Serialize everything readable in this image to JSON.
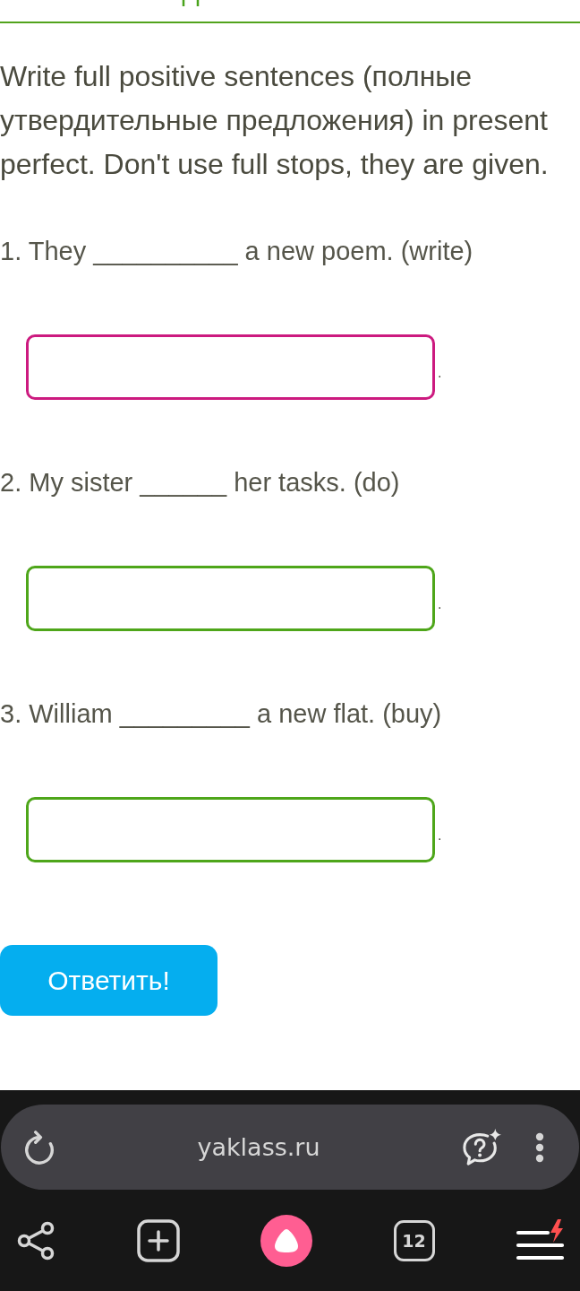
{
  "instruction": "Write full positive sentences (полные утвердительные предложения) in present perfect. Don't use full stops, they are given.",
  "questions": [
    {
      "prompt": "1. They __________ a new poem. (write)",
      "answer": {
        "focused": true
      },
      "end_mark": "."
    },
    {
      "prompt": "2. My sister ______ her tasks. (do)",
      "answer": {
        "focused": false
      },
      "end_mark": "."
    },
    {
      "prompt": "3. William _________ a new flat. (buy)",
      "answer": {
        "focused": false
      },
      "end_mark": "."
    }
  ],
  "submit_button": {
    "label": "Ответить!"
  },
  "address_bar": {
    "url": "yaklass.ru"
  },
  "bottom_nav": {
    "tabs_count": "12"
  }
}
